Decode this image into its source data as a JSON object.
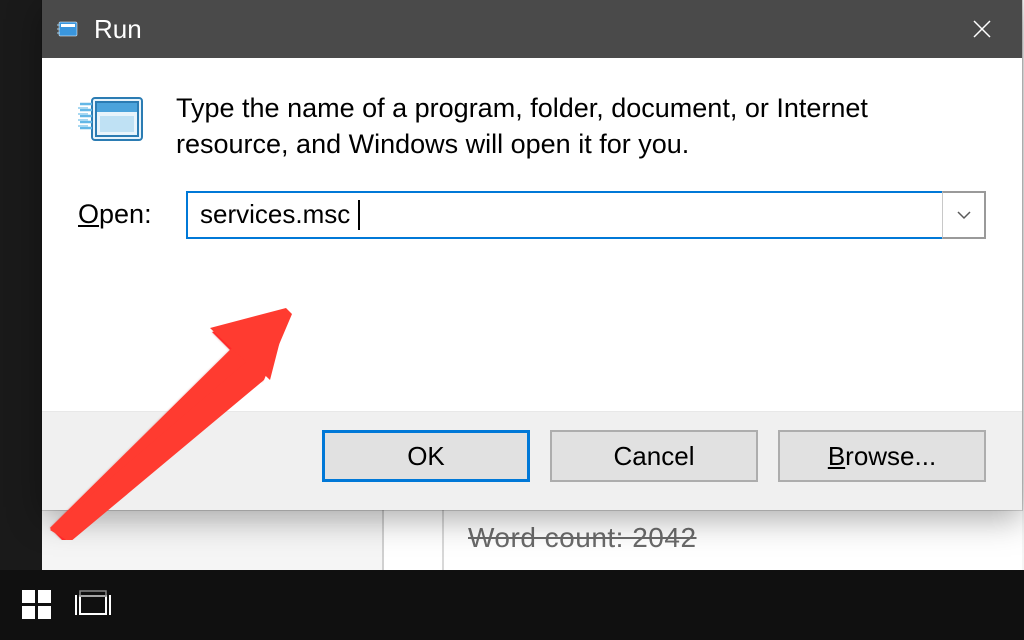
{
  "dialog": {
    "title": "Run",
    "description": "Type the name of a program, folder, document, or Internet resource, and Windows will open it for you.",
    "open_label_pre": "O",
    "open_label_rest": "pen:",
    "input_value": "services.msc",
    "buttons": {
      "ok": "OK",
      "cancel": "Cancel",
      "browse_pre": "B",
      "browse_rest": "rowse..."
    }
  },
  "behind": {
    "word_count": "Word count: 2042"
  }
}
